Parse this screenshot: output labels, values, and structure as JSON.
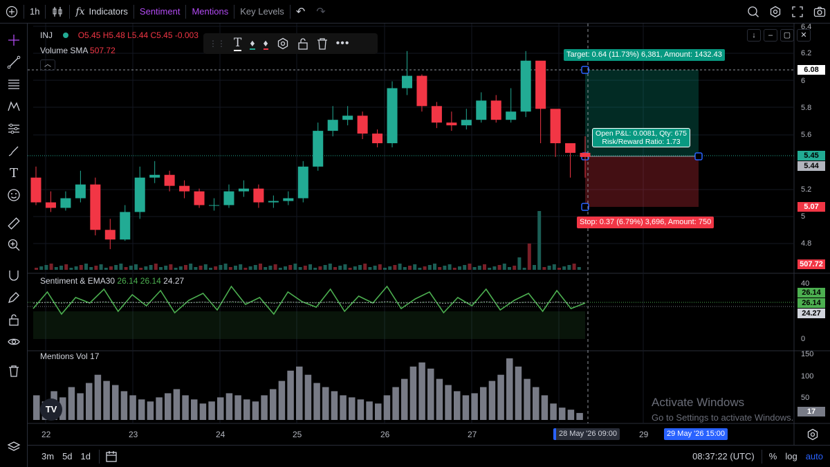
{
  "topbar": {
    "timeframe": "1h",
    "indicators_label": "Indicators",
    "sentiment_label": "Sentiment",
    "mentions_label": "Mentions",
    "key_levels_label": "Key Levels"
  },
  "price_legend": {
    "symbol": "INJ",
    "open": "O5.45",
    "high": "H5.48",
    "low": "L5.44",
    "close": "C5.45",
    "change": "-0.003",
    "volume_label": "Volume SMA",
    "volume_value": "507.72"
  },
  "sentiment_legend": {
    "label": "Sentiment & EMA30",
    "v1": "26.14",
    "v2": "26.14",
    "v3": "24.27"
  },
  "mentions_legend": {
    "label": "Mentions Vol",
    "value": "17"
  },
  "price_axis": {
    "ticks": [
      "6.4",
      "6.2",
      "6",
      "5.8",
      "5.6",
      "5.2",
      "5",
      "4.8"
    ],
    "tags": {
      "target": "6.08",
      "current": "5.45",
      "last": "5.44",
      "stop": "5.07",
      "volume": "507.72"
    }
  },
  "sentiment_axis": {
    "ticks": [
      "40",
      "20",
      "0"
    ],
    "tags": [
      "26.14",
      "26.14",
      "24.27"
    ]
  },
  "mentions_axis": {
    "ticks": [
      "150",
      "100",
      "50"
    ],
    "tag": "17"
  },
  "time_axis": {
    "ticks": [
      "22",
      "23",
      "24",
      "25",
      "26",
      "27",
      "29"
    ],
    "crosshair_start": "28 May '26  09:00",
    "crosshair_end": "29 May '26  15:00"
  },
  "position": {
    "target_label": "Target: 0.64 (11.73%) 6,381, Amount: 1432.43",
    "stop_label": "Stop: 0.37 (6.79%) 3,696, Amount: 750",
    "pnl_line1": "Open P&L: 0.0081, Qty: 675",
    "pnl_line2": "Risk/Reward Ratio: 1.73"
  },
  "bottombar": {
    "ranges": [
      "3m",
      "5d",
      "1d"
    ],
    "clock": "08:37:22 (UTC)",
    "percent": "%",
    "log": "log",
    "auto": "auto"
  },
  "watermark": {
    "line1": "Activate Windows",
    "line2": "Go to Settings to activate Windows."
  },
  "colors": {
    "up": "#22ab94",
    "down": "#f23645",
    "accent": "#2962ff",
    "purple": "#b24bf3",
    "sentiment": "#4caf50"
  },
  "chart_data": [
    {
      "type": "candlestick",
      "title": "INJ",
      "x": [
        "22",
        "23",
        "24",
        "25",
        "26",
        "27",
        "28"
      ],
      "ylim": [
        4.7,
        6.4
      ],
      "open": [
        5.3,
        5.12,
        5.08,
        5.15,
        5.25,
        4.92,
        4.85,
        5.05,
        5.3,
        5.32,
        5.24,
        5.2,
        5.1,
        5.1,
        5.2,
        5.22,
        5.12,
        5.13,
        5.15,
        5.38,
        5.64,
        5.72,
        5.75,
        5.62,
        5.55,
        5.95,
        6.04,
        5.82,
        5.7,
        5.68,
        5.72,
        5.86,
        5.72,
        5.78,
        6.15,
        5.8,
        5.55,
        5.48
      ],
      "close": [
        5.12,
        5.08,
        5.15,
        5.25,
        4.92,
        4.85,
        5.05,
        5.3,
        5.32,
        5.24,
        5.2,
        5.1,
        5.1,
        5.2,
        5.22,
        5.12,
        5.13,
        5.15,
        5.38,
        5.64,
        5.72,
        5.75,
        5.62,
        5.55,
        5.95,
        6.04,
        5.82,
        5.7,
        5.68,
        5.72,
        5.86,
        5.72,
        5.78,
        6.15,
        5.8,
        5.55,
        5.48,
        5.45
      ],
      "high": [
        5.38,
        5.2,
        5.2,
        5.35,
        5.3,
        5.0,
        5.1,
        5.38,
        5.42,
        5.35,
        5.28,
        5.22,
        5.15,
        5.25,
        5.28,
        5.25,
        5.17,
        5.2,
        5.42,
        5.7,
        5.82,
        5.82,
        5.78,
        5.65,
        6.0,
        6.22,
        6.05,
        5.85,
        5.78,
        5.8,
        5.92,
        5.9,
        5.95,
        6.22,
        6.1,
        5.62,
        5.52,
        5.6
      ],
      "low": [
        5.1,
        5.05,
        5.06,
        5.12,
        4.88,
        4.78,
        4.84,
        5.0,
        5.26,
        5.2,
        5.15,
        5.08,
        5.06,
        5.08,
        5.16,
        5.08,
        5.08,
        5.1,
        5.12,
        5.35,
        5.6,
        5.68,
        5.58,
        5.52,
        5.52,
        5.9,
        5.78,
        5.66,
        5.64,
        5.65,
        5.7,
        5.7,
        5.7,
        5.74,
        5.55,
        5.45,
        5.3,
        5.3
      ]
    },
    {
      "type": "line",
      "title": "Sentiment & EMA30",
      "ylim": [
        0,
        40
      ],
      "series": [
        {
          "name": "Sentiment",
          "values": [
            22,
            34,
            18,
            30,
            26,
            36,
            20,
            32,
            24,
            35,
            19,
            28,
            33,
            21,
            38,
            25,
            30,
            18,
            34,
            27,
            23,
            36,
            20,
            31,
            26,
            38,
            22,
            29,
            34,
            19,
            30,
            24,
            36,
            21,
            28,
            33,
            20,
            35,
            22,
            26
          ]
        },
        {
          "name": "EMA30",
          "values": [
            26,
            26.5,
            26,
            26.4,
            26.2,
            26.8,
            26.1,
            26.5,
            26.2,
            26.9,
            26,
            26.2,
            26.7,
            26.1,
            27,
            26.5,
            26.6,
            25.9,
            26.7,
            26.4,
            26.1,
            26.8,
            25.9,
            26.4,
            26.2,
            27,
            26,
            26.3,
            26.7,
            25.8,
            26.4,
            26,
            26.9,
            25.9,
            26.2,
            26.6,
            25.8,
            26.8,
            25.9,
            26.14
          ]
        }
      ]
    },
    {
      "type": "bar",
      "title": "Mentions Vol",
      "ylim": [
        0,
        160
      ],
      "values": [
        60,
        45,
        70,
        55,
        80,
        65,
        90,
        110,
        95,
        85,
        70,
        60,
        50,
        45,
        55,
        65,
        75,
        60,
        50,
        40,
        45,
        55,
        65,
        60,
        50,
        45,
        60,
        75,
        95,
        120,
        130,
        110,
        90,
        80,
        70,
        60,
        55,
        50,
        45,
        40,
        60,
        80,
        100,
        130,
        140,
        125,
        100,
        85,
        70,
        60,
        65,
        80,
        95,
        110,
        150,
        130,
        100,
        80,
        60,
        40,
        30,
        25,
        17
      ]
    }
  ]
}
